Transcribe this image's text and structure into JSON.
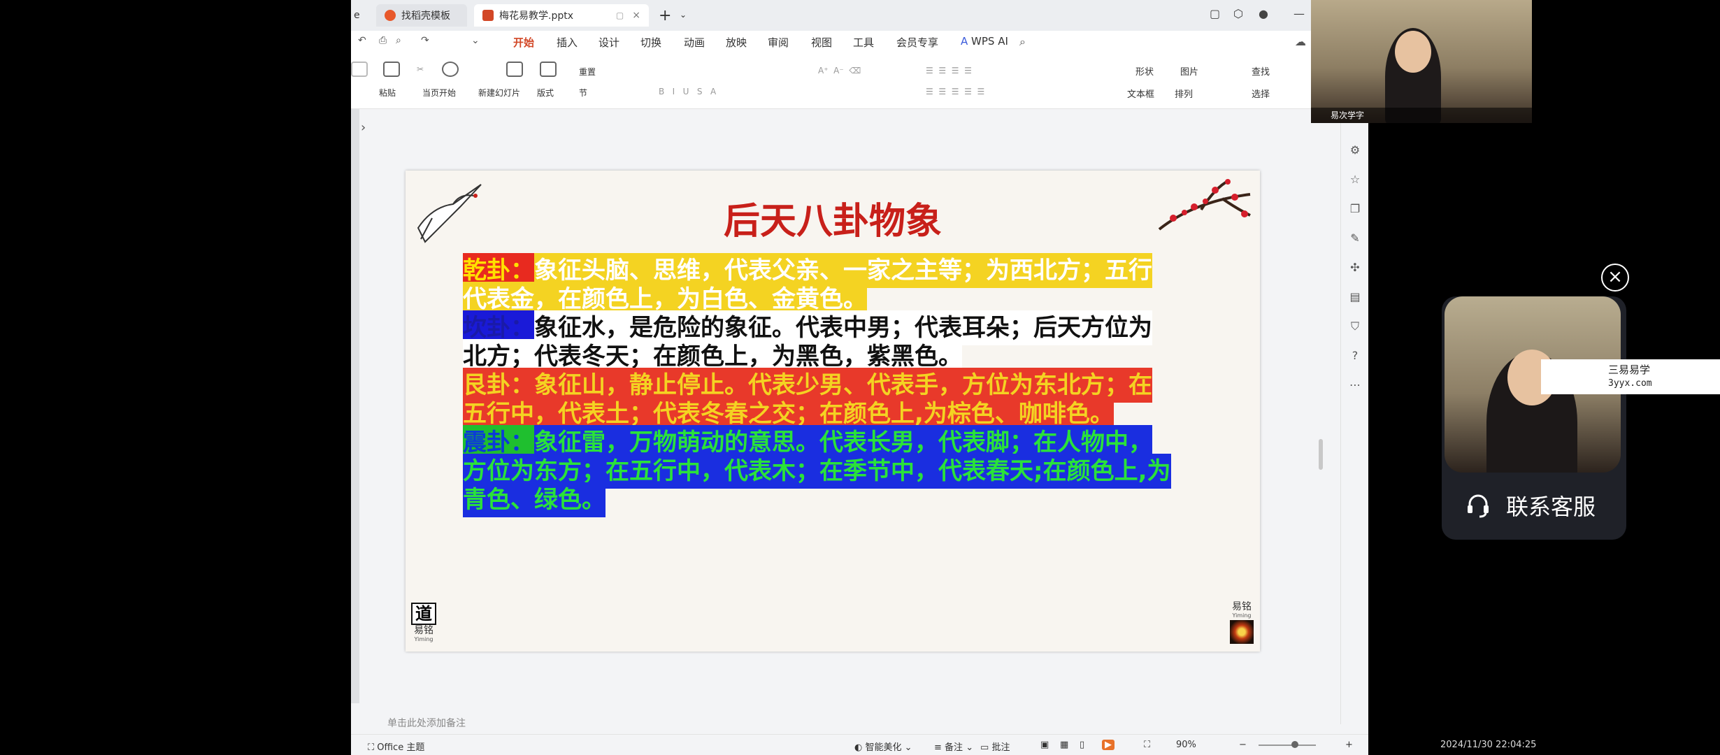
{
  "tabs": [
    {
      "label": "e"
    },
    {
      "label": "找稻壳模板",
      "icon_color": "#e8582a"
    },
    {
      "label": "梅花易教学.pptx",
      "icon_color": "#d24726"
    }
  ],
  "tab_min": "▢",
  "tab_close": "×",
  "tab_plus": "+",
  "tab_dropdown": "⌄",
  "menu": [
    "开始",
    "插入",
    "设计",
    "切换",
    "动画",
    "放映",
    "审阅",
    "视图",
    "工具",
    "会员专享",
    "WPS AI"
  ],
  "active_menu": "开始",
  "ribbon": {
    "paste": "粘贴",
    "from_current": "当页开始",
    "new_slide": "新建幻灯片",
    "layout": "版式",
    "section": "节",
    "reset": "重置",
    "shape": "形状",
    "picture": "图片",
    "textbox": "文本框",
    "arrange": "排列",
    "find": "查找",
    "select": "选择"
  },
  "slide": {
    "title": "后天八卦物象",
    "lines": [
      [
        {
          "t": "乾卦：",
          "c": "#ffe000",
          "bg": "#e82a1f"
        },
        {
          "t": "象征头脑、思维，代表父亲、一家之主等；为西北方；五行",
          "c": "#ffffff",
          "bg": "#f4d322"
        }
      ],
      [
        {
          "t": "代表金，在颜色上，为白色、金黄色。",
          "c": "#ffffff",
          "bg": "#f4d322"
        }
      ],
      [
        {
          "t": "坎卦：",
          "c": "#1a1aa8",
          "bg": "#1a1ad8"
        },
        {
          "t": "象征水，是危险的象征。代表中男；代表耳朵；后天方位为",
          "c": "#111111",
          "bg": "#ffffff"
        }
      ],
      [
        {
          "t": "北方；代表冬天；在颜色上，为黑色，紫黑色。",
          "c": "#111111",
          "bg": "#ffffff"
        }
      ],
      [
        {
          "t": "艮卦：",
          "c": "#f4d322",
          "bg": "#e8392a"
        },
        {
          "t": "象征山，静止停止。代表少男、代表手，方位为东北方；在",
          "c": "#f4d322",
          "bg": "#e8392a"
        }
      ],
      [
        {
          "t": "五行中，代表土；代表冬春之交；在颜色上,为棕色、咖啡色。",
          "c": "#f4d322",
          "bg": "#e8392a"
        }
      ],
      [
        {
          "t": "震卦：",
          "c": "#0b3bd8",
          "bg": "#1fbf2f"
        },
        {
          "t": "象征雷，万物萌动的意思。代表长男，代表脚；在人物中，",
          "c": "#2ae23a",
          "bg": "#1a2ee0"
        }
      ],
      [
        {
          "t": "方位为东方；在五行中，代表木；在季节中，代表春天;在颜色上,为",
          "c": "#2ae23a",
          "bg": "#1a2ee0"
        }
      ],
      [
        {
          "t": "青色、绿色。",
          "c": "#2ae23a",
          "bg": "#1a2ee0"
        }
      ]
    ],
    "seal_left_char": "道",
    "seal_left_name": "易铭",
    "seal_left_en": "Yiming",
    "seal_right_name": "易铭",
    "seal_right_en": "Yiming"
  },
  "notes_placeholder": "单击此处添加备注",
  "status": {
    "theme": "Office 主题",
    "beautify": "智能美化",
    "notes": "备注",
    "comments": "批注",
    "zoom": "90%",
    "minus": "−",
    "plus": "+"
  },
  "video_top_label": "易次学字",
  "contact_label": "联系客服",
  "close_symbol": "×",
  "watermark": {
    "line1": "三易易学",
    "line2": "3yyx.com"
  },
  "timestamp": "2024/11/30 22:04:25",
  "colors": {
    "accent": "#d24726",
    "title_red": "#c8201a"
  }
}
